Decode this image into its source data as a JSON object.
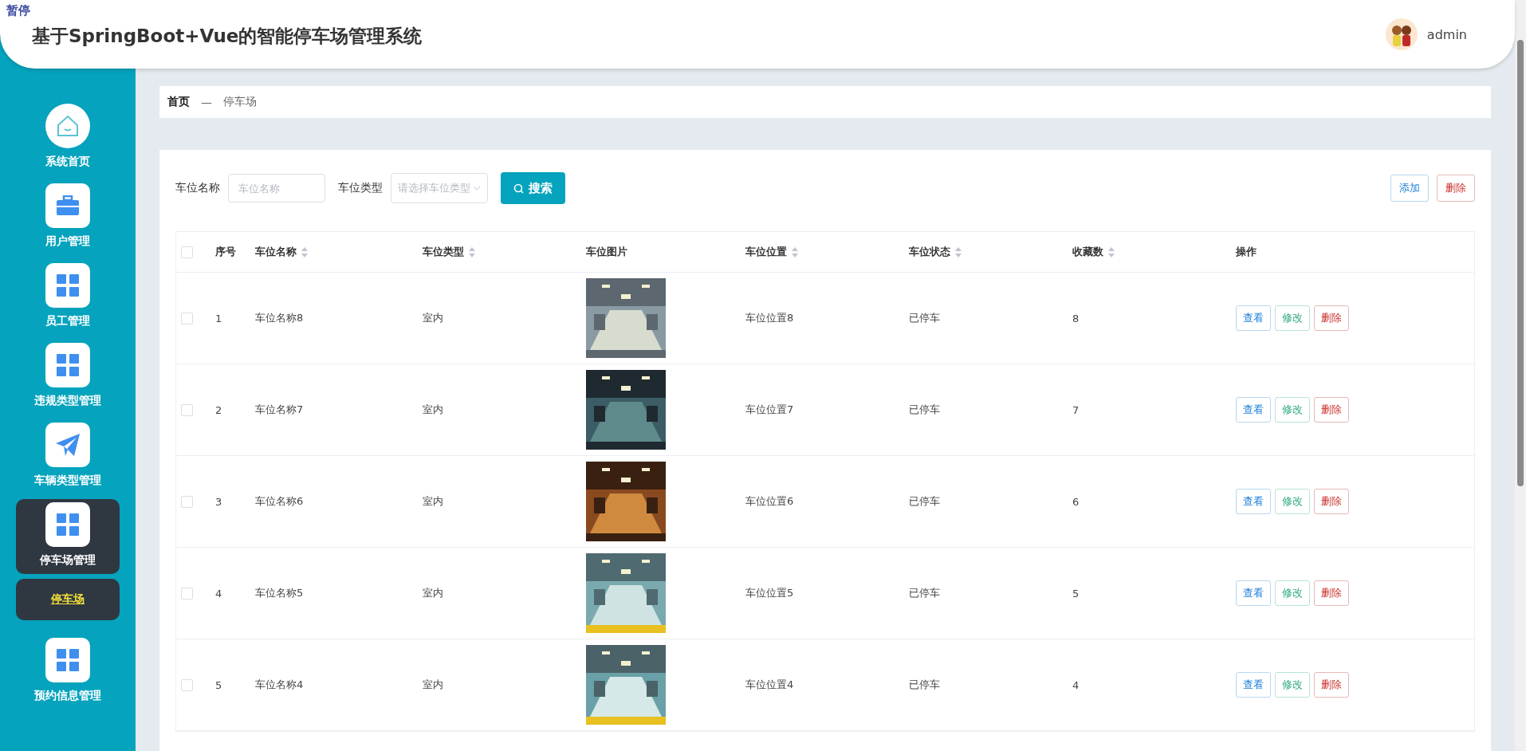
{
  "overlay_label": "暂停",
  "header": {
    "title": "基于SpringBoot+Vue的智能停车场管理系统",
    "user": "admin"
  },
  "sidebar": {
    "items": [
      {
        "label": "系统首页",
        "selected": false
      },
      {
        "label": "用户管理",
        "selected": false
      },
      {
        "label": "员工管理",
        "selected": false
      },
      {
        "label": "违规类型管理",
        "selected": false
      },
      {
        "label": "车辆类型管理",
        "selected": false
      },
      {
        "label": "停车场管理",
        "selected": true,
        "expanded": true,
        "children": [
          {
            "label": "停车场",
            "selected": true
          }
        ]
      },
      {
        "label": "预约信息管理",
        "selected": false
      }
    ]
  },
  "breadcrumb": {
    "items": [
      "首页",
      "停车场"
    ],
    "separator": "—"
  },
  "search": {
    "fields": [
      {
        "kind": "input",
        "label": "车位名称",
        "placeholder": "车位名称"
      },
      {
        "kind": "select",
        "label": "车位类型",
        "placeholder": "请选择车位类型"
      }
    ],
    "button": "搜索"
  },
  "actions": [
    {
      "kind": "add",
      "label": "添加"
    },
    {
      "kind": "delete",
      "label": "删除"
    }
  ],
  "table": {
    "header_checked": false,
    "columns": [
      {
        "label": "序号",
        "sortable": false
      },
      {
        "label": "车位名称",
        "sortable": true
      },
      {
        "label": "车位类型",
        "sortable": true
      },
      {
        "label": "车位图片",
        "sortable": false
      },
      {
        "label": "车位位置",
        "sortable": true
      },
      {
        "label": "车位状态",
        "sortable": true
      },
      {
        "label": "收藏数",
        "sortable": true
      },
      {
        "label": "操作",
        "sortable": false
      }
    ],
    "rows": [
      {
        "checked": false,
        "index": "1",
        "name": "车位名称8",
        "type": "室内",
        "location": "车位位置8",
        "status": "已停车",
        "favorites": "8",
        "buttons": [
          {
            "kind": "view",
            "label": "查看"
          },
          {
            "kind": "edit",
            "label": "修改"
          },
          {
            "kind": "delete",
            "label": "删除"
          }
        ]
      },
      {
        "checked": false,
        "index": "2",
        "name": "车位名称7",
        "type": "室内",
        "location": "车位位置7",
        "status": "已停车",
        "favorites": "7",
        "buttons": [
          {
            "kind": "view",
            "label": "查看"
          },
          {
            "kind": "edit",
            "label": "修改"
          },
          {
            "kind": "delete",
            "label": "删除"
          }
        ]
      },
      {
        "checked": false,
        "index": "3",
        "name": "车位名称6",
        "type": "室内",
        "location": "车位位置6",
        "status": "已停车",
        "favorites": "6",
        "buttons": [
          {
            "kind": "view",
            "label": "查看"
          },
          {
            "kind": "edit",
            "label": "修改"
          },
          {
            "kind": "delete",
            "label": "删除"
          }
        ]
      },
      {
        "checked": false,
        "index": "4",
        "name": "车位名称5",
        "type": "室内",
        "location": "车位位置5",
        "status": "已停车",
        "favorites": "5",
        "buttons": [
          {
            "kind": "view",
            "label": "查看"
          },
          {
            "kind": "edit",
            "label": "修改"
          },
          {
            "kind": "delete",
            "label": "删除"
          }
        ]
      },
      {
        "checked": false,
        "index": "5",
        "name": "车位名称4",
        "type": "室内",
        "location": "车位位置4",
        "status": "已停车",
        "favorites": "4",
        "buttons": [
          {
            "kind": "view",
            "label": "查看"
          },
          {
            "kind": "edit",
            "label": "修改"
          },
          {
            "kind": "delete",
            "label": "删除"
          }
        ]
      }
    ]
  }
}
